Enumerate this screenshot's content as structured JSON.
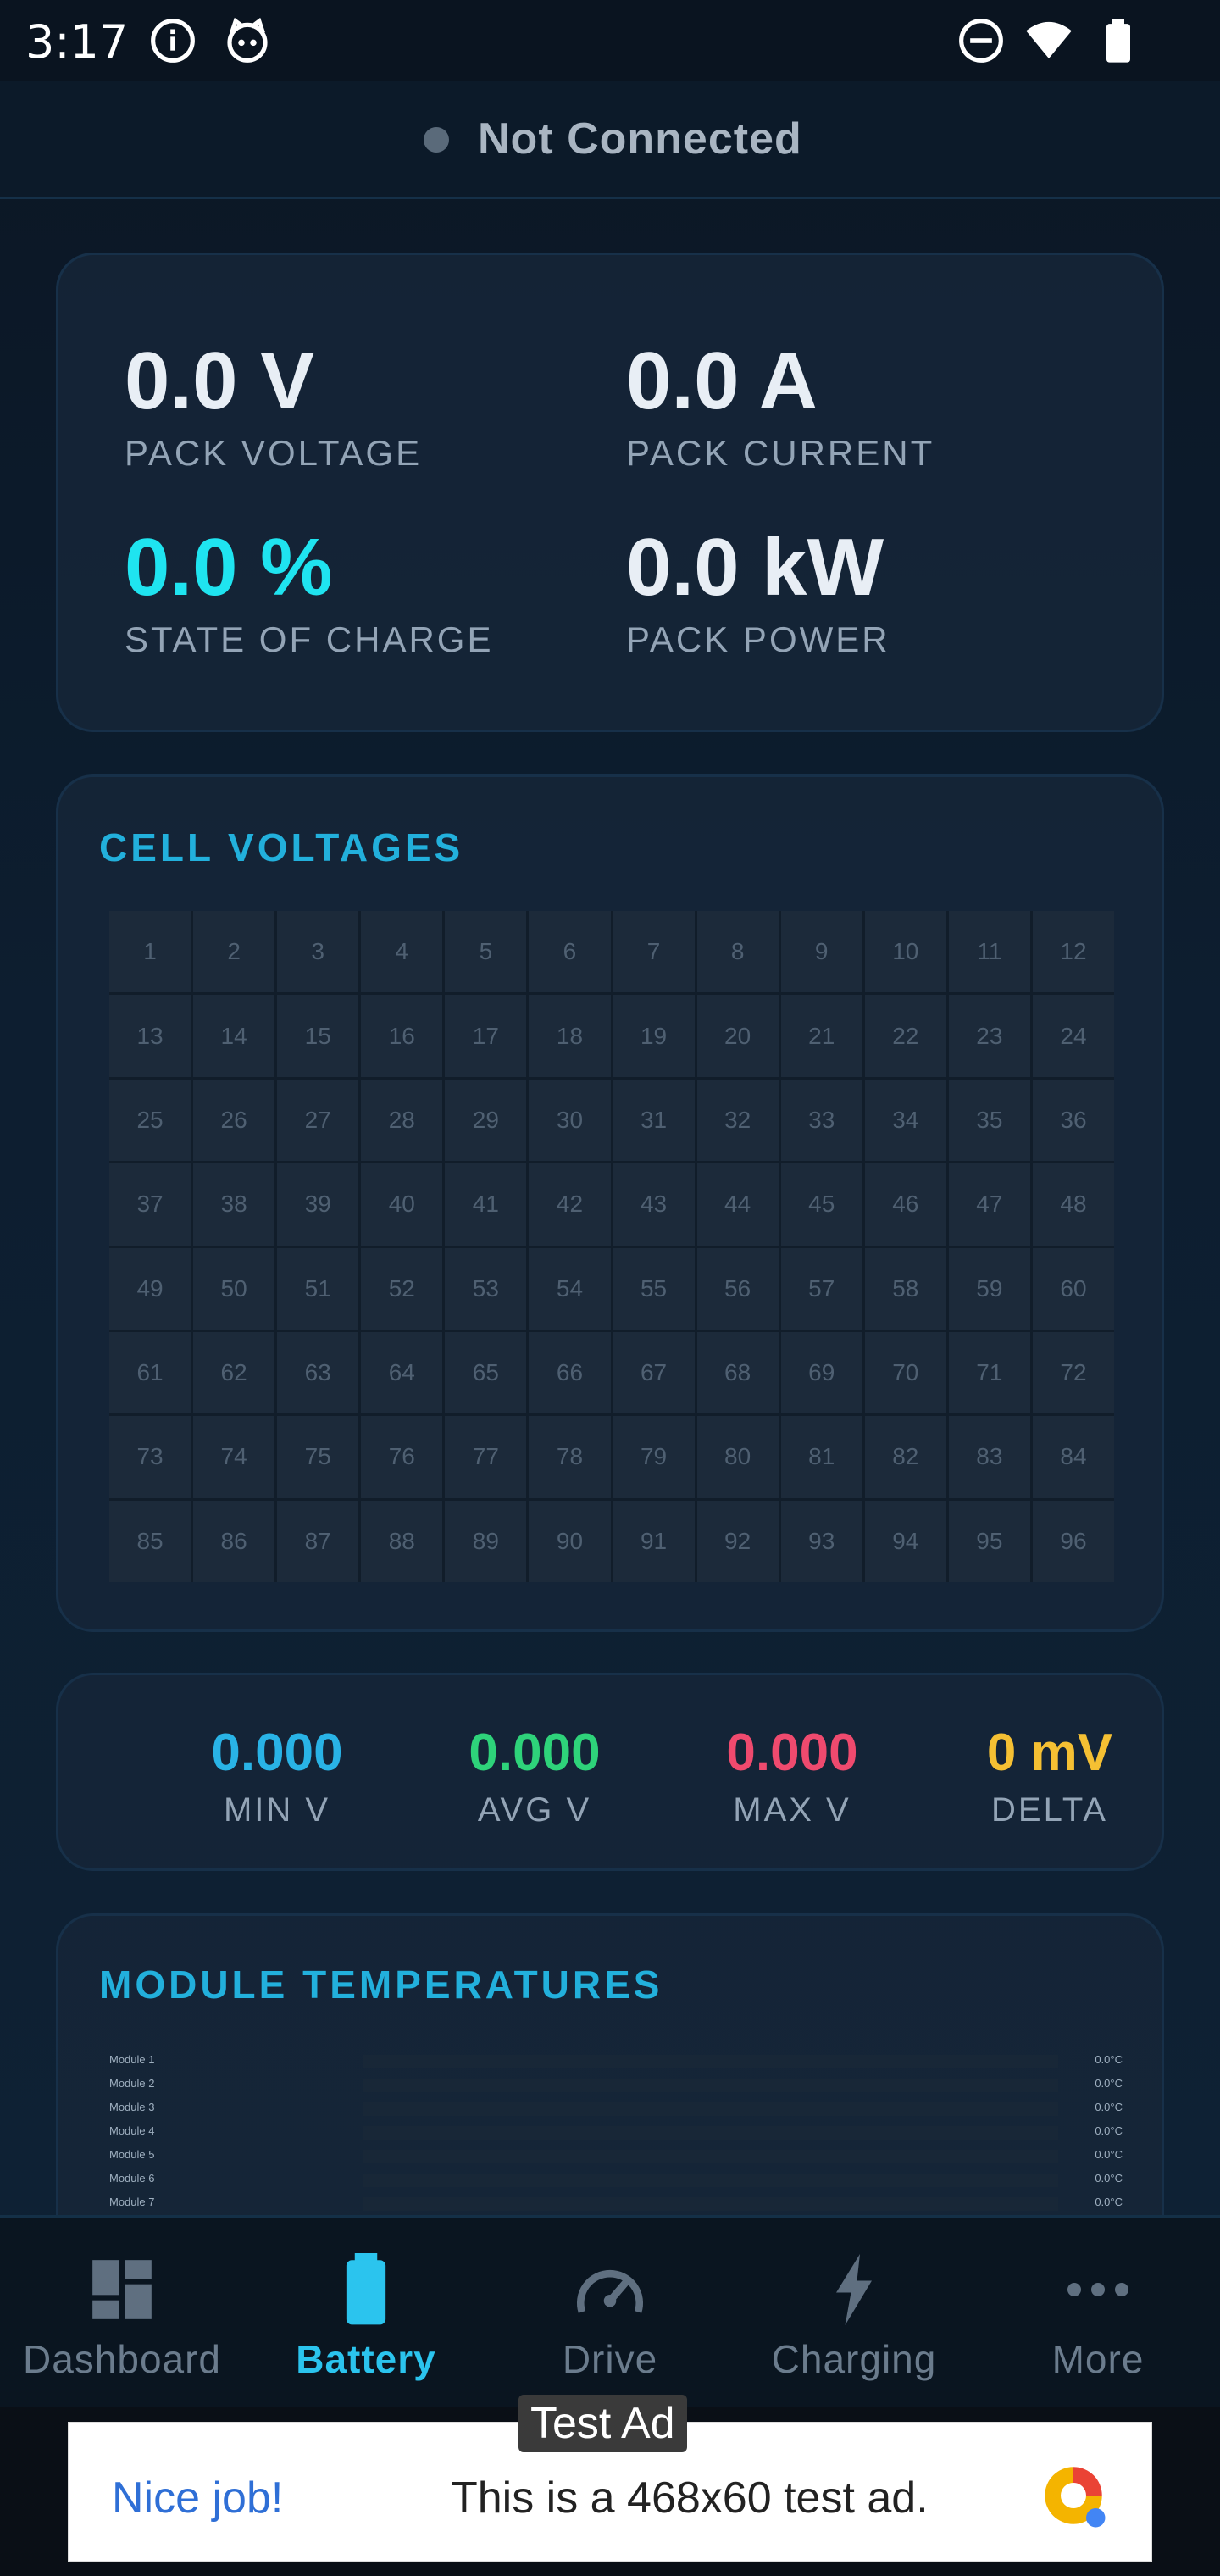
{
  "status_bar": {
    "time": "3:17",
    "left_icons": [
      "info-icon",
      "cat-icon"
    ],
    "right_icons": [
      "do-not-disturb-icon",
      "wifi-icon",
      "battery-icon"
    ]
  },
  "connection": {
    "status": "Not Connected",
    "dot_color": "#5a6a7a"
  },
  "pack": {
    "voltage": {
      "value": "0.0 V",
      "label": "PACK VOLTAGE"
    },
    "current": {
      "value": "0.0 A",
      "label": "PACK CURRENT"
    },
    "soc": {
      "value": "0.0 %",
      "label": "STATE OF CHARGE",
      "color": "#1fe4f0"
    },
    "power": {
      "value": "0.0 kW",
      "label": "PACK POWER"
    }
  },
  "cell_voltages": {
    "title": "CELL VOLTAGES",
    "cells": [
      "1",
      "2",
      "3",
      "4",
      "5",
      "6",
      "7",
      "8",
      "9",
      "10",
      "11",
      "12",
      "13",
      "14",
      "15",
      "16",
      "17",
      "18",
      "19",
      "20",
      "21",
      "22",
      "23",
      "24",
      "25",
      "26",
      "27",
      "28",
      "29",
      "30",
      "31",
      "32",
      "33",
      "34",
      "35",
      "36",
      "37",
      "38",
      "39",
      "40",
      "41",
      "42",
      "43",
      "44",
      "45",
      "46",
      "47",
      "48",
      "49",
      "50",
      "51",
      "52",
      "53",
      "54",
      "55",
      "56",
      "57",
      "58",
      "59",
      "60",
      "61",
      "62",
      "63",
      "64",
      "65",
      "66",
      "67",
      "68",
      "69",
      "70",
      "71",
      "72",
      "73",
      "74",
      "75",
      "76",
      "77",
      "78",
      "79",
      "80",
      "81",
      "82",
      "83",
      "84",
      "85",
      "86",
      "87",
      "88",
      "89",
      "90",
      "91",
      "92",
      "93",
      "94",
      "95",
      "96"
    ]
  },
  "summary": {
    "min": {
      "value": "0.000",
      "label": "MIN V",
      "color": "#29b3e6"
    },
    "avg": {
      "value": "0.000",
      "label": "AVG V",
      "color": "#2ed37a"
    },
    "max": {
      "value": "0.000",
      "label": "MAX V",
      "color": "#ef4a6e"
    },
    "delta": {
      "value": "0 mV",
      "label": "DELTA",
      "color": "#f5c033"
    }
  },
  "module_temperatures": {
    "title": "MODULE TEMPERATURES",
    "modules": [
      {
        "name": "Module 1",
        "value": "0.0°C"
      },
      {
        "name": "Module 2",
        "value": "0.0°C"
      },
      {
        "name": "Module 3",
        "value": "0.0°C"
      },
      {
        "name": "Module 4",
        "value": "0.0°C"
      },
      {
        "name": "Module 5",
        "value": "0.0°C"
      },
      {
        "name": "Module 6",
        "value": "0.0°C"
      },
      {
        "name": "Module 7",
        "value": "0.0°C"
      }
    ]
  },
  "nav": {
    "active": "Battery",
    "accent": "#2bc4ee",
    "items": [
      {
        "label": "Dashboard",
        "icon": "dashboard-icon"
      },
      {
        "label": "Battery",
        "icon": "battery-icon"
      },
      {
        "label": "Drive",
        "icon": "speedometer-icon"
      },
      {
        "label": "Charging",
        "icon": "bolt-icon"
      },
      {
        "label": "More",
        "icon": "more-dots-icon"
      }
    ]
  },
  "ad": {
    "tag": "Test Ad",
    "headline": "Nice job!",
    "body": "This is a 468x60 test ad."
  }
}
